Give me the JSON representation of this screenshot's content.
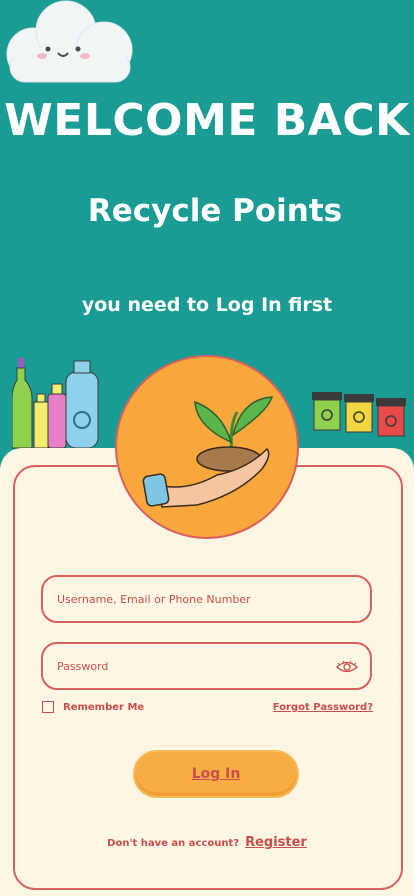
{
  "hero": {
    "title": "WELCOME BACK",
    "subtitle": "Recycle Points",
    "tagline": "you need to Log In first"
  },
  "login_form": {
    "username_placeholder": "Username, Email or Phone Number",
    "password_placeholder": "Password",
    "remember_label": "Remember Me",
    "forgot_label": "Forgot Password?",
    "login_label": "Log In",
    "register_question": "Don't have an account?",
    "register_label": "Register"
  },
  "icons": {
    "cloud": "cloud-icon",
    "bottles": "bottles-icon",
    "bins": "recycling-bins-icon",
    "plant": "plant-in-hand-icon",
    "eye": "eye-icon"
  },
  "colors": {
    "background": "#1a9c94",
    "panel": "#fdf6e3",
    "accent": "#d8605d",
    "button": "#f8ad44"
  }
}
